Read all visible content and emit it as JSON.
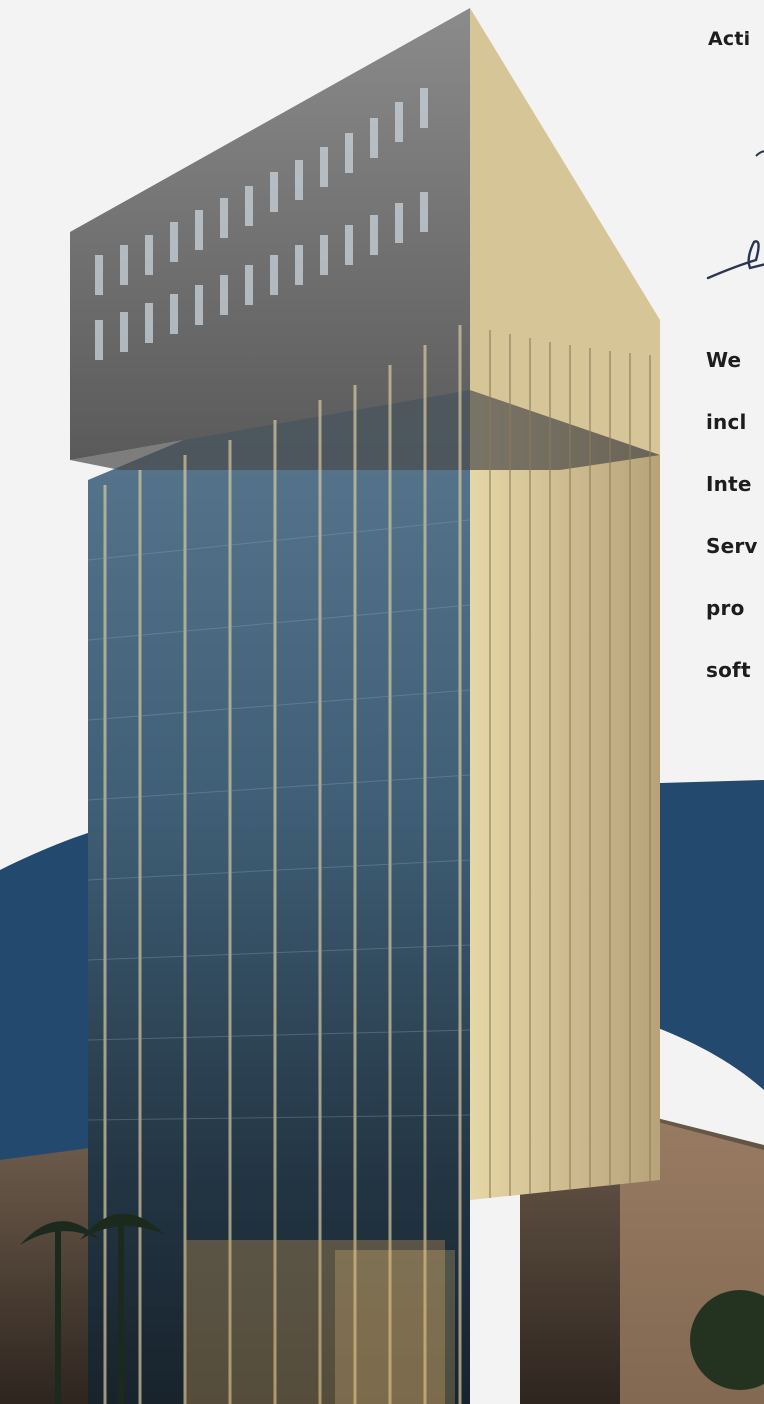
{
  "intro": {
    "eyebrow": "Acti",
    "lines": [
      "We",
      "incl",
      "Inte",
      "Serv",
      "pro",
      "soft"
    ]
  },
  "colors": {
    "background": "#f3f3f3",
    "accent_shape": "#234a6e",
    "text": "#1d1d1d"
  },
  "images": {
    "building": "glass-office-tower-illustration",
    "signature": "handwritten-signature"
  }
}
